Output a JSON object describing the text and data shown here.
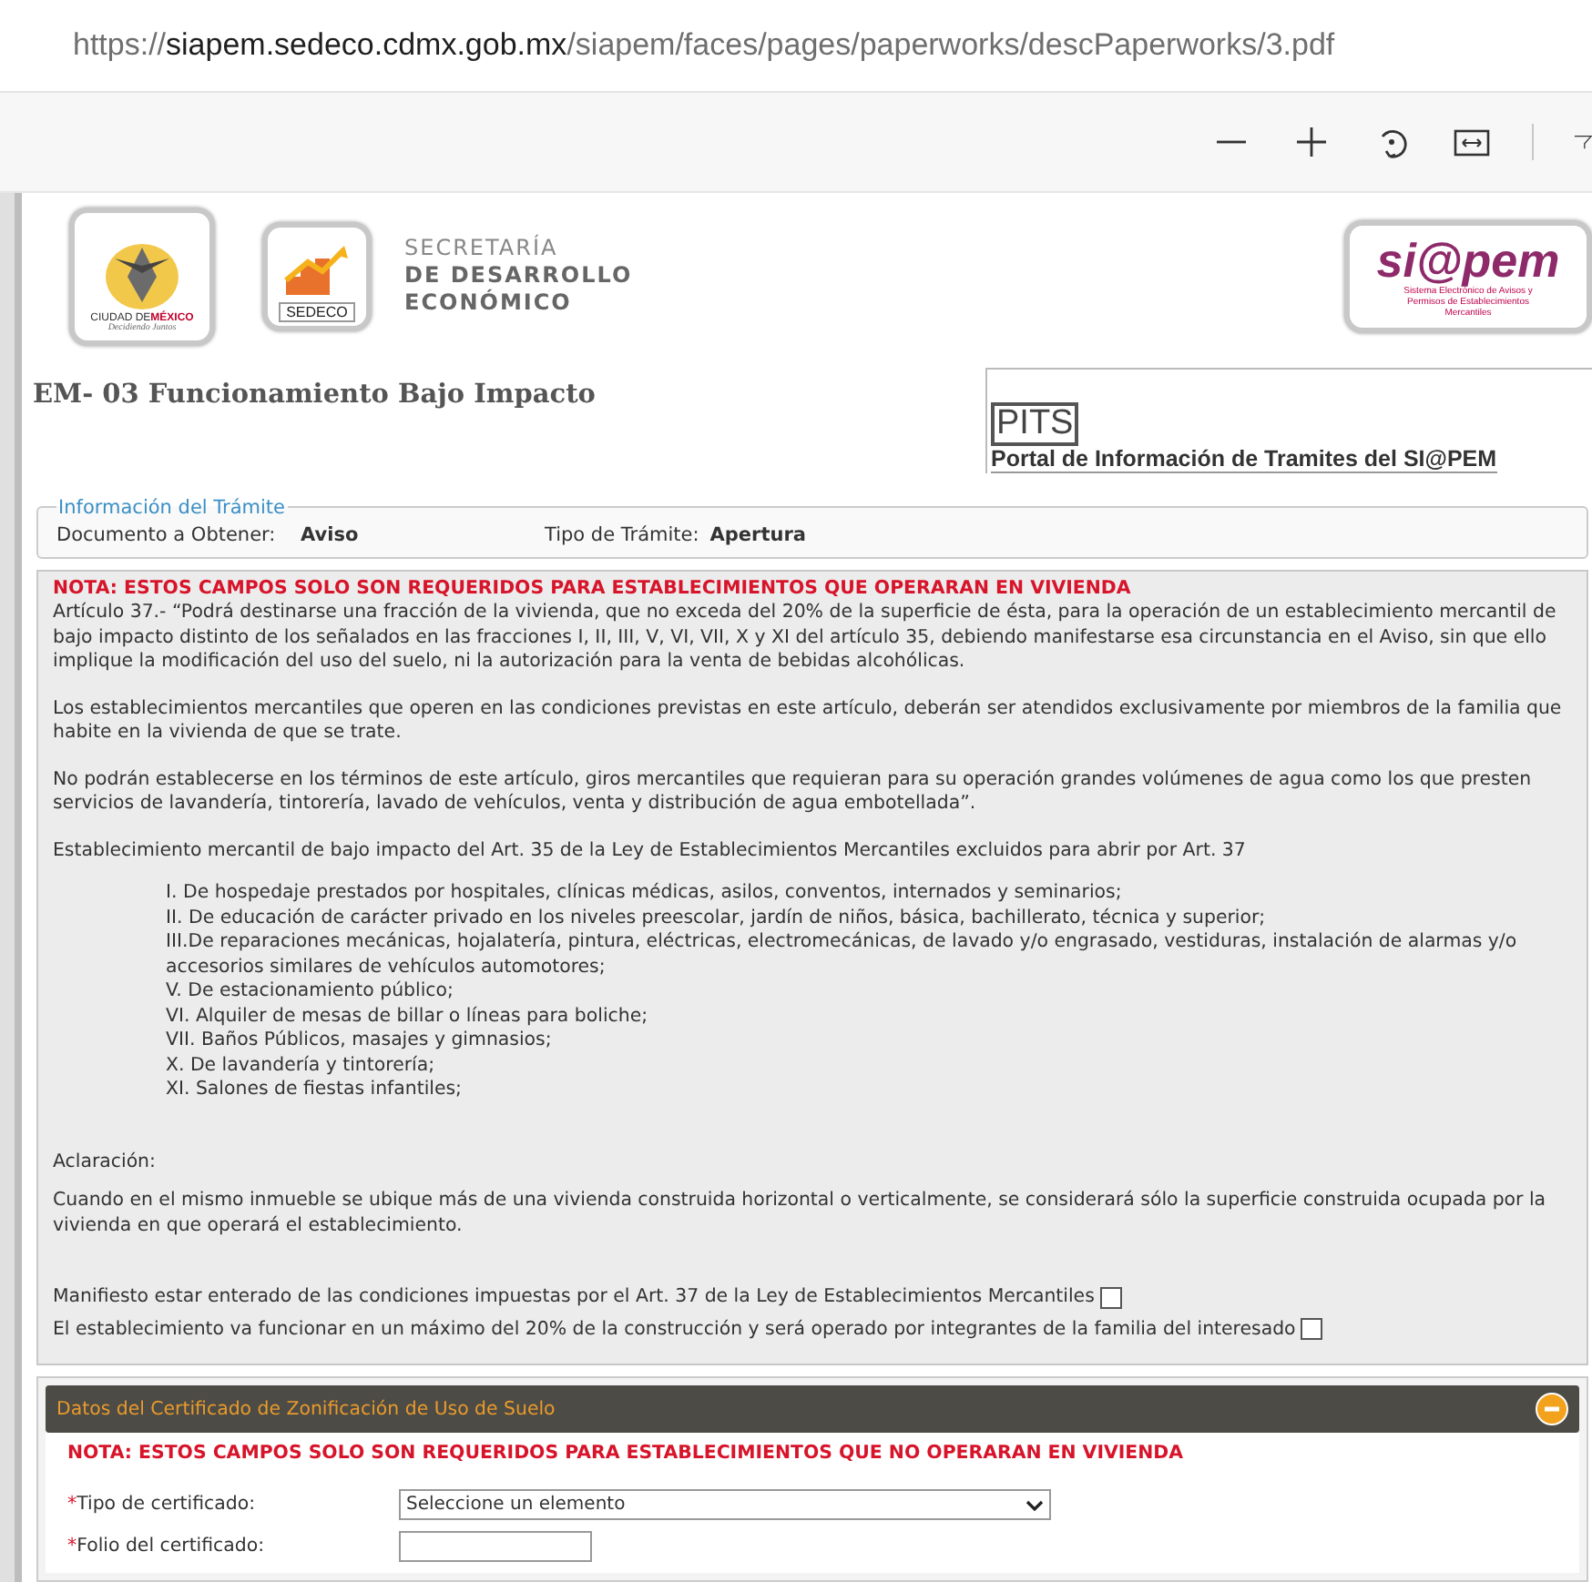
{
  "browser": {
    "url": {
      "scheme": "https://",
      "host": "siapem.sedeco.cdmx.gob.mx",
      "path": "/siapem/faces/pages/paperworks/descPaperworks/3.pdf"
    }
  },
  "header": {
    "cdmx_logo": {
      "name_a": "CIUDAD DE",
      "name_b": "MÉXICO",
      "motto": "Decidiendo Juntos"
    },
    "sedeco_logo": "SEDECO",
    "secretaria": [
      "SECRETARÍA",
      "DE DESARROLLO",
      "ECONÓMICO"
    ],
    "siapem_logo": {
      "name": "si@pem",
      "tagline": "Sistema Electrónico de Avisos y Permisos de Establecimientos Mercantiles"
    }
  },
  "title": "EM- 03 Funcionamiento Bajo Impacto",
  "pits": {
    "badge": "PITS",
    "caption": "Portal de Información de Tramites del SI@PEM"
  },
  "tramite_info": {
    "legend": "Información del Trámite",
    "fields": [
      {
        "label": "Documento a Obtener:",
        "value": "Aviso"
      },
      {
        "label": "Tipo de Trámite:",
        "value": "Apertura"
      }
    ]
  },
  "vivienda_note": {
    "heading": "NOTA: ESTOS CAMPOS SOLO SON REQUERIDOS PARA ESTABLECIMIENTOS QUE OPERARAN EN VIVIENDA",
    "paragraphs": [
      "Artículo 37.- “Podrá destinarse una fracción de la vivienda, que no exceda del 20% de la superficie de ésta, para la operación de un establecimiento mercantil de bajo impacto distinto de los señalados en las fracciones I, II, III, V, VI, VII, X y XI del artículo 35, debiendo manifestarse esa circunstancia en el Aviso, sin que ello implique la modificación del uso del suelo, ni la autorización para la venta de bebidas alcohólicas.",
      "Los establecimientos mercantiles que operen en las condiciones previstas en este artículo, deberán ser atendidos exclusivamente por miembros de la familia que habite en la vivienda de que se trate.",
      "No podrán establecerse en los términos de este artículo, giros mercantiles que requieran para su operación grandes volúmenes de agua como los que presten servicios de lavandería, tintorería, lavado de vehículos, venta y distribución de agua embotellada”."
    ],
    "list_intro": "Establecimiento mercantil de bajo impacto del Art. 35 de la Ley de Establecimientos Mercantiles excluidos para abrir por Art. 37",
    "excluded": [
      "I. De hospedaje prestados por hospitales, clínicas médicas, asilos, conventos, internados y seminarios;",
      "II. De educación de carácter privado en los niveles preescolar, jardín de niños, básica, bachillerato, técnica y superior;",
      "III.De reparaciones mecánicas, hojalatería, pintura, eléctricas, electromecánicas, de lavado y/o engrasado, vestiduras, instalación de alarmas y/o accesorios similares de vehículos automotores;",
      "V. De estacionamiento público;",
      "VI. Alquiler de mesas de billar o líneas para boliche;",
      "VII. Baños Públicos, masajes y gimnasios;",
      "X. De lavandería y tintorería;",
      "XI. Salones de fiestas infantiles;"
    ],
    "clarification_label": "Aclaración:",
    "clarification": "Cuando en el mismo inmueble se ubique más de una vivienda construida horizontal o verticalmente, se considerará sólo la superficie construida ocupada por la vivienda en que operará el establecimiento.",
    "declarations": [
      {
        "label": "Manifiesto estar enterado de las condiciones impuestas por el Art. 37 de la Ley de Establecimientos Mercantiles",
        "checked": false
      },
      {
        "label": "El establecimiento va funcionar en un máximo del 20% de la construcción y será operado por integrantes de la familia del interesado",
        "checked": false
      }
    ]
  },
  "certificate_panel": {
    "title": "Datos del Certificado de Zonificación de Uso de Suelo",
    "expanded": true,
    "note": "NOTA: ESTOS CAMPOS SOLO SON REQUERIDOS PARA ESTABLECIMIENTOS QUE NO OPERARAN EN VIVIENDA",
    "fields": [
      {
        "kind": "select",
        "mark": "*",
        "label": "Tipo de certificado:",
        "value": "Seleccione un elemento"
      },
      {
        "kind": "text",
        "mark": "*",
        "label": "Folio del certificado:"
      }
    ]
  }
}
